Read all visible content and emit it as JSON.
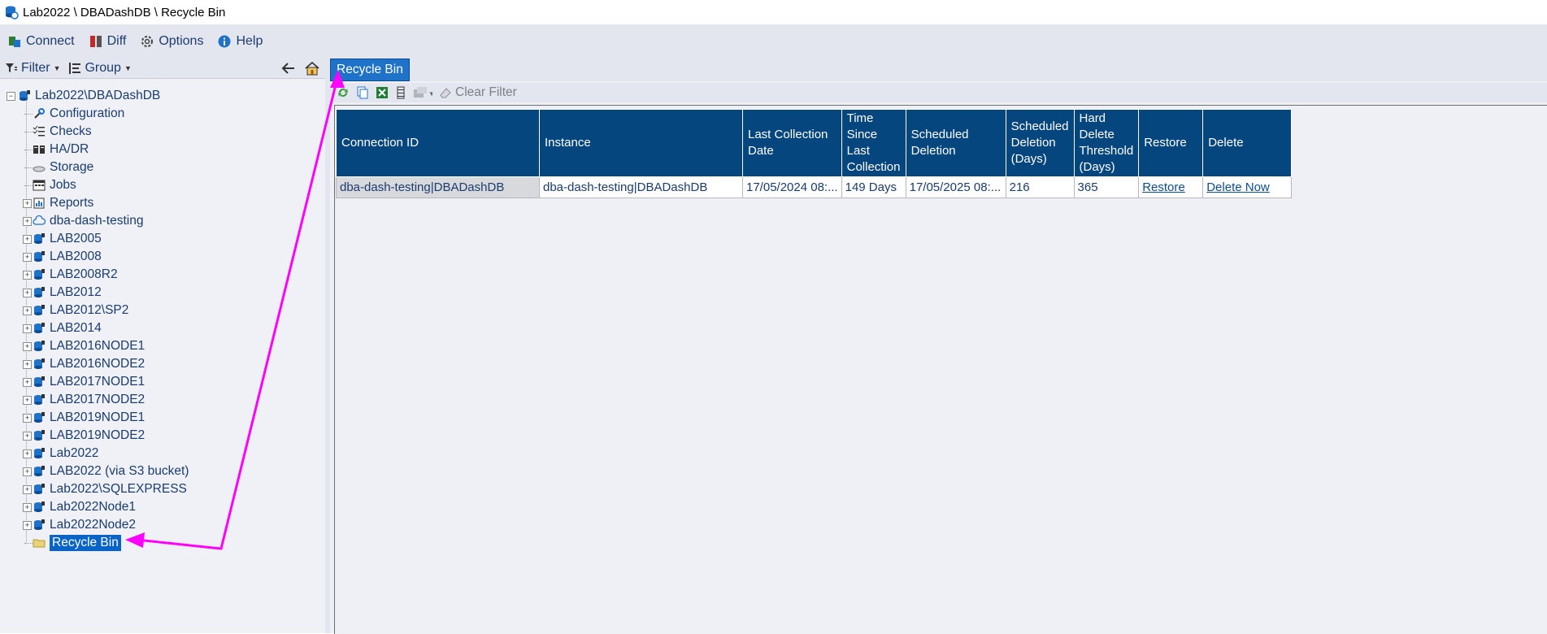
{
  "window": {
    "title": "Lab2022 \\ DBADashDB \\ Recycle Bin"
  },
  "menu": {
    "connect": "Connect",
    "diff": "Diff",
    "options": "Options",
    "help": "Help"
  },
  "left_toolbar": {
    "filter": "Filter",
    "group": "Group"
  },
  "tree": {
    "root": "Lab2022\\DBADashDB",
    "children": [
      "Configuration",
      "Checks",
      "HA/DR",
      "Storage",
      "Jobs"
    ],
    "expandable": [
      "Reports",
      "dba-dash-testing",
      "LAB2005",
      "LAB2008",
      "LAB2008R2",
      "LAB2012",
      "LAB2012\\SP2",
      "LAB2014",
      "LAB2016NODE1",
      "LAB2016NODE2",
      "LAB2017NODE1",
      "LAB2017NODE2",
      "LAB2019NODE1",
      "LAB2019NODE2",
      "Lab2022",
      "LAB2022 (via S3 bucket)",
      "Lab2022\\SQLEXPRESS",
      "Lab2022Node1",
      "Lab2022Node2"
    ],
    "selected": "Recycle Bin"
  },
  "tab": {
    "label": "Recycle Bin"
  },
  "grid_toolbar": {
    "clear_filter": "Clear Filter"
  },
  "grid": {
    "headers": [
      "Connection ID",
      "Instance",
      "Last Collection Date",
      "Time Since Last Collection",
      "Scheduled Deletion",
      "Scheduled Deletion (Days)",
      "Hard Delete Threshold (Days)",
      "Restore",
      "Delete"
    ],
    "rows": [
      [
        "dba-dash-testing|DBADashDB",
        "dba-dash-testing|DBADashDB",
        "17/05/2024 08:...",
        "149 Days",
        "17/05/2025 08:...",
        "216",
        "365",
        "Restore",
        "Delete Now"
      ]
    ]
  },
  "colors": {
    "accent": "#0a64c8",
    "header": "#05467e",
    "annotation": "#ff00ff"
  }
}
